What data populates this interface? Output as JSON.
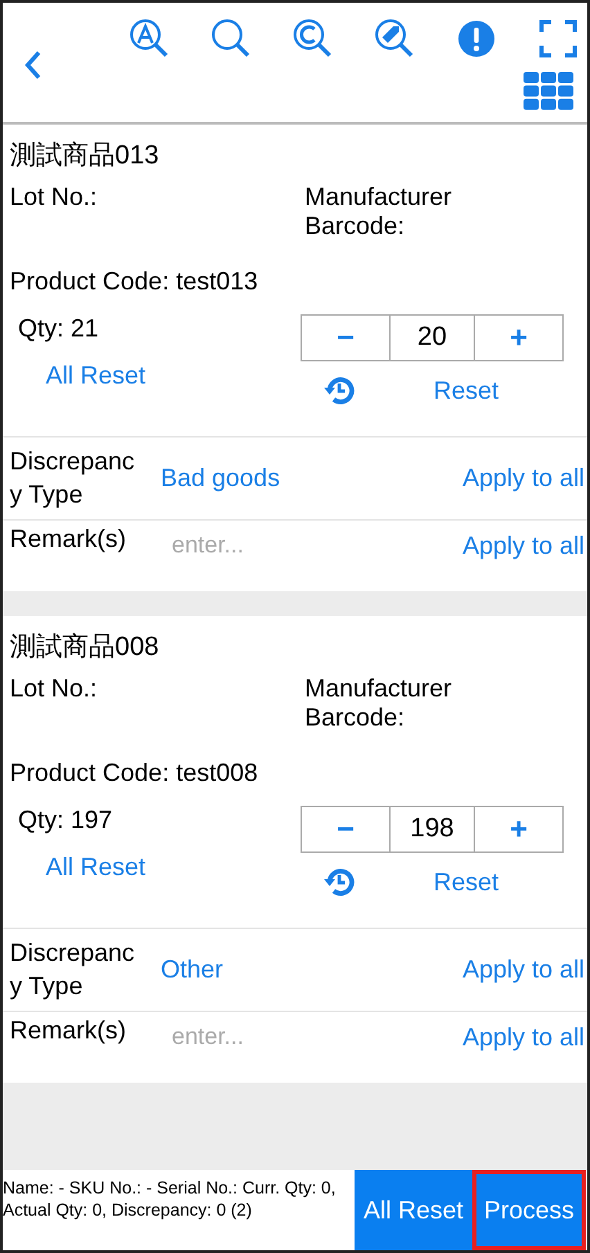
{
  "toolbar": {
    "icons": [
      {
        "kind": "a-search"
      },
      {
        "kind": "search"
      },
      {
        "kind": "c-search"
      },
      {
        "kind": "tag-search"
      },
      {
        "kind": "alert"
      },
      {
        "kind": "scan"
      }
    ]
  },
  "items": [
    {
      "name": "測試商品013",
      "lot_label": "Lot No.:",
      "barcode_label": "Manufacturer Barcode:",
      "product_code": "Product Code: test013",
      "qty": "Qty: 21",
      "all_reset": "All Reset",
      "minus": "−",
      "value": "20",
      "plus": "+",
      "reset": "Reset",
      "discrepancy_label": "Discrepancy Type",
      "discrepancy_value": "Bad goods",
      "apply_discrepancy": "Apply to all",
      "remark_label": "Remark(s)",
      "remark_placeholder": "enter...",
      "apply_remark": "Apply to all"
    },
    {
      "name": "測試商品008",
      "lot_label": "Lot No.:",
      "barcode_label": "Manufacturer Barcode:",
      "product_code": "Product Code: test008",
      "qty": "Qty: 197",
      "all_reset": "All Reset",
      "minus": "−",
      "value": "198",
      "plus": "+",
      "reset": "Reset",
      "discrepancy_label": "Discrepancy Type",
      "discrepancy_value": "Other",
      "apply_discrepancy": "Apply to all",
      "remark_label": "Remark(s)",
      "remark_placeholder": "enter...",
      "apply_remark": "Apply to all"
    }
  ],
  "footer": {
    "summary": "Name: - SKU No.: - Serial No.: Curr. Qty: 0, Actual Qty: 0, Discrepancy: 0 (2)",
    "buttons": [
      {
        "label": "All Reset",
        "highlighted": false
      },
      {
        "label": "Process",
        "highlighted": true
      }
    ]
  }
}
